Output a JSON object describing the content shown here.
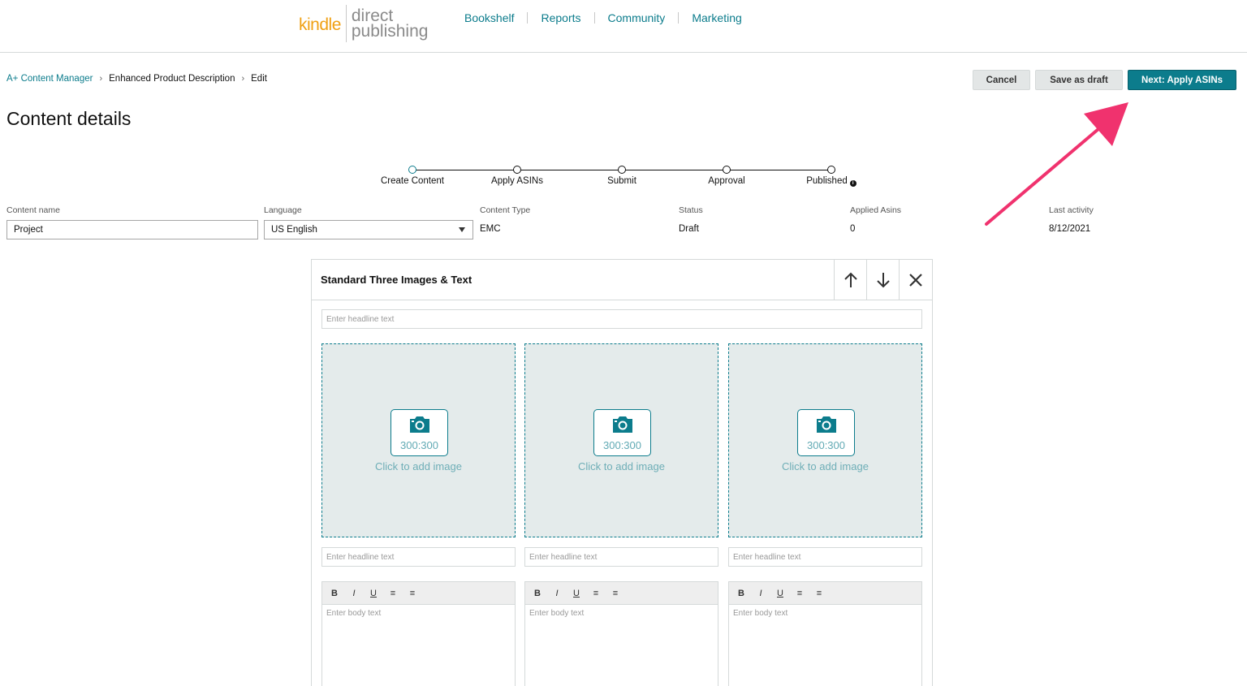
{
  "logo": {
    "kindle": "kindle",
    "direct": "direct",
    "publishing": "publishing"
  },
  "nav": [
    "Bookshelf",
    "Reports",
    "Community",
    "Marketing"
  ],
  "breadcrumb": [
    "A+ Content Manager",
    "Enhanced Product Description",
    "Edit"
  ],
  "actions": {
    "cancel": "Cancel",
    "save_draft": "Save as draft",
    "next": "Next: Apply ASINs"
  },
  "page_title": "Content details",
  "steps": [
    "Create Content",
    "Apply ASINs",
    "Submit",
    "Approval",
    "Published"
  ],
  "details": {
    "content_name_label": "Content name",
    "content_name_value": "Project",
    "language_label": "Language",
    "language_value": "US English",
    "content_type_label": "Content Type",
    "content_type_value": "EMC",
    "status_label": "Status",
    "status_value": "Draft",
    "applied_asins_label": "Applied Asins",
    "applied_asins_value": "0",
    "last_activity_label": "Last activity",
    "last_activity_value": "8/12/2021"
  },
  "module": {
    "title": "Standard Three Images & Text",
    "headline_placeholder": "Enter headline text",
    "image_ratio": "300:300",
    "add_image": "Click to add image",
    "column_headline_placeholder": "Enter headline text",
    "body_placeholder": "Enter body text",
    "toolbar": [
      "B",
      "I",
      "U"
    ]
  },
  "colors": {
    "accent": "#0c7c8c",
    "kindle_orange": "#f0a013",
    "arrow": "#f0326e"
  }
}
